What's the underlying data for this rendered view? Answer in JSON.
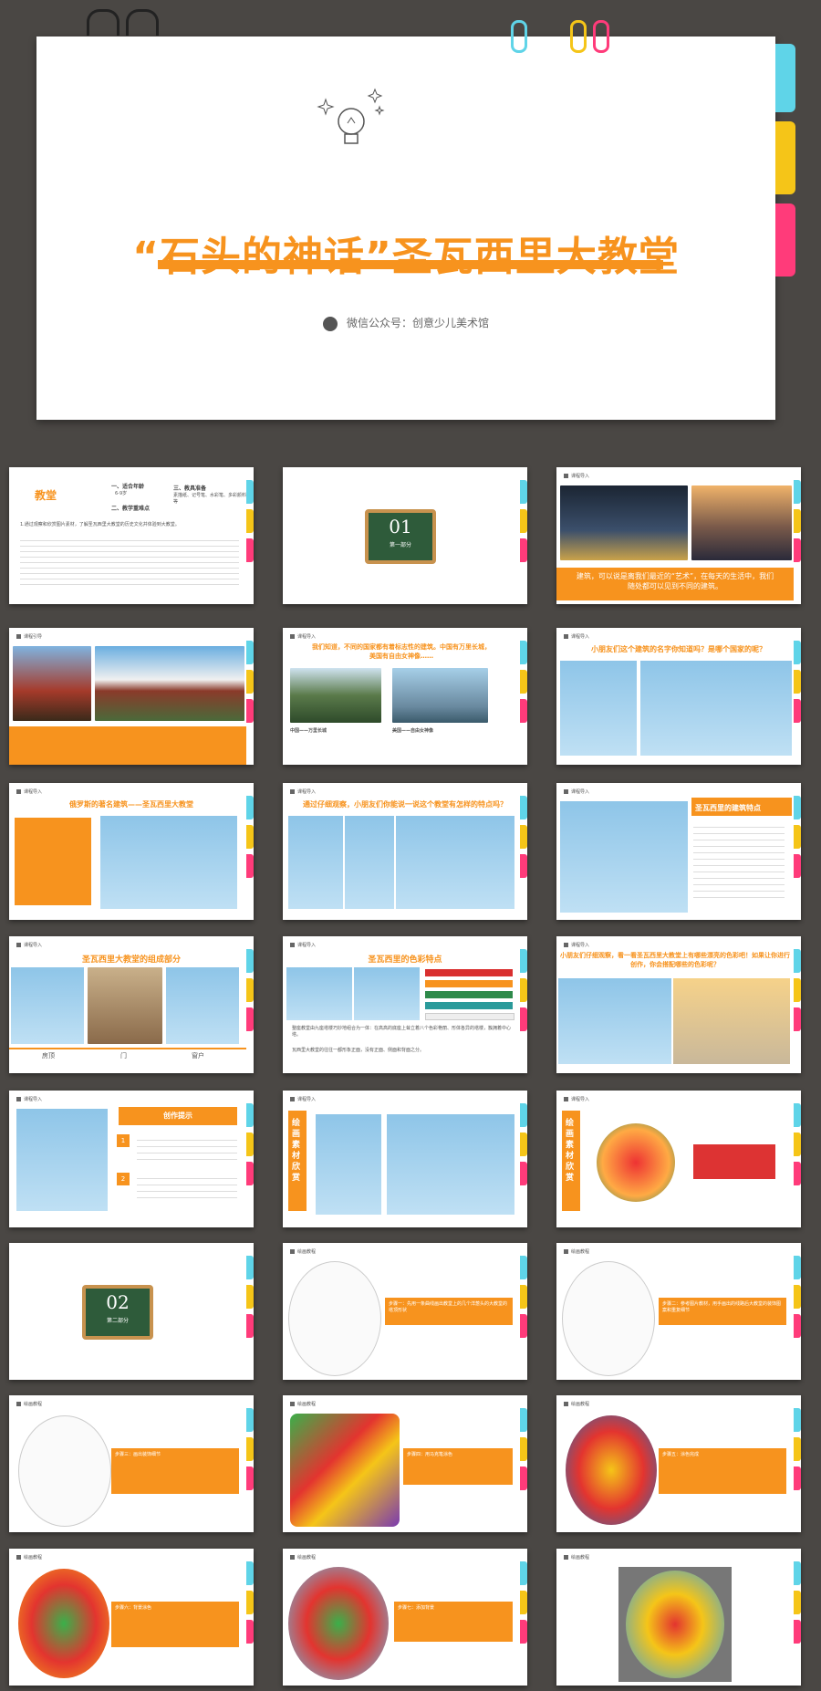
{
  "cover": {
    "title": "“石头的神话”圣瓦西里大教堂",
    "subtitle": "微信公众号：创意少儿美术馆",
    "colors": {
      "accent": "#f7931e",
      "tab_cyan": "#5fd4e8",
      "tab_yellow": "#f5c518",
      "tab_pink": "#ff3b7a"
    }
  },
  "slides": [
    {
      "id": "s1",
      "heading": "教堂",
      "items": [
        "一、适合年龄",
        "三、教具准备",
        "二、教学重难点"
      ],
      "sub": [
        "6-9岁",
        "素描纸、记号笔、水彩笔、多彩颜料等"
      ],
      "body": "1.通过观察和欣赏图片素材，了解圣瓦西里大教堂的历史文化并体验到大教堂。"
    },
    {
      "id": "s2",
      "board_number": "01",
      "board_label": "第一部分"
    },
    {
      "id": "s3",
      "category": "课程导入",
      "caption": "建筑，可以说是离我们最近的“艺术”，在每天的生活中，我们随处都可以见到不同的建筑。"
    },
    {
      "id": "s4",
      "category": "课程引导"
    },
    {
      "id": "s5",
      "category": "课程导入",
      "heading": "我们知道，不同的国家都有着标志性的建筑。中国有万里长城，美国有自由女神像……",
      "labels": [
        "中国——万里长城",
        "美国——自由女神像"
      ]
    },
    {
      "id": "s6",
      "category": "课程导入",
      "heading": "小朋友们这个建筑的名字你知道吗？是哪个国家的呢？"
    },
    {
      "id": "s7",
      "category": "课程导入",
      "heading": "俄罗斯的著名建筑——圣瓦西里大教堂"
    },
    {
      "id": "s8",
      "category": "课程导入",
      "heading": "通过仔细观察，小朋友们你能说一说这个教堂有怎样的特点吗？"
    },
    {
      "id": "s9",
      "category": "课程导入",
      "heading": "圣瓦西里的建筑特点"
    },
    {
      "id": "s10",
      "category": "课程导入",
      "heading": "圣瓦西里大教堂的组成部分",
      "labels": [
        "房顶",
        "门",
        "窗户"
      ]
    },
    {
      "id": "s11",
      "category": "课程导入",
      "heading": "圣瓦西里的色彩特点",
      "bullets": [
        "整座教堂由九座塔楼巧妙地组合为一体：在高高的底座上耸立着八个色彩艳丽、形体各异的塔楼，簇拥着中心塔。",
        "瓦西里大教堂的往往一都形象正面，没有正面、侧面和背面之分。"
      ]
    },
    {
      "id": "s12",
      "category": "课程导入",
      "heading": "小朋友们仔细观察，看一看圣瓦西里大教堂上有哪些漂亮的色彩吧！如果让你进行创作，你会搭配哪些的色彩呢？"
    },
    {
      "id": "s13",
      "category": "课程导入",
      "heading": "创作提示",
      "items": [
        "1",
        "2"
      ]
    },
    {
      "id": "s14",
      "category": "课程导入",
      "side_label": "绘画素材欣赏"
    },
    {
      "id": "s15",
      "category": "课程导入",
      "side_label": "绘画素材欣赏"
    },
    {
      "id": "s16",
      "board_number": "02",
      "board_label": "第二部分"
    },
    {
      "id": "s17",
      "category": "绘画教程",
      "step": "步骤一：先用一条曲线画出教堂上的几个洋葱头的大教堂的塔顶形状"
    },
    {
      "id": "s18",
      "category": "绘画教程",
      "step": "步骤二：参考图片教材，用手画出的线路后大教堂的装饰图案和重复细节"
    },
    {
      "id": "s19",
      "category": "绘画教程",
      "step": "步骤三：画出装饰细节"
    },
    {
      "id": "s20",
      "category": "绘画教程",
      "step": "步骤四：用马克笔涂色"
    },
    {
      "id": "s21",
      "category": "绘画教程",
      "step": "步骤五：涂色完成"
    },
    {
      "id": "s22",
      "category": "绘画教程",
      "step": "步骤六：背景涂色"
    },
    {
      "id": "s23",
      "category": "绘画教程",
      "step": "步骤七：添加背景"
    },
    {
      "id": "s24",
      "category": "绘画教程"
    }
  ]
}
